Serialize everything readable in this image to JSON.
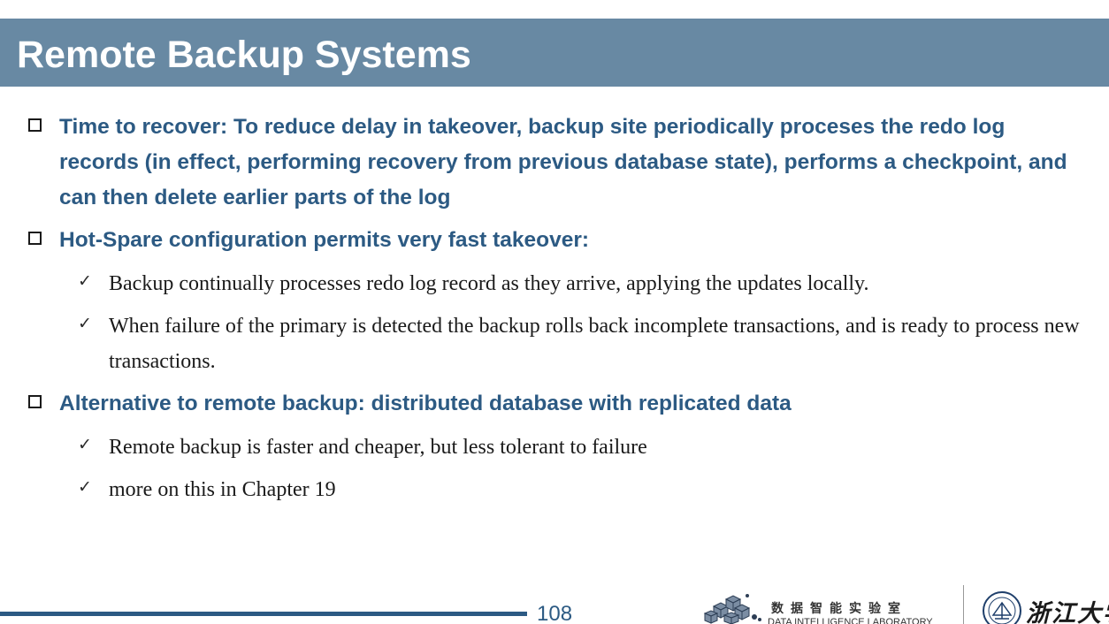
{
  "slide": {
    "title": "Remote Backup Systems",
    "bullets": [
      {
        "text": "Time to recover: To reduce delay in takeover, backup site periodically proceses the redo log records (in effect, performing recovery from previous database state), performs a checkpoint, and can then delete earlier parts of the log",
        "subitems": []
      },
      {
        "text": "Hot-Spare configuration permits very fast takeover:",
        "subitems": [
          "Backup continually processes redo log record as they arrive, applying the updates locally.",
          "When failure of the primary is detected the backup rolls back incomplete transactions, and is ready to  process new transactions."
        ]
      },
      {
        "text": "Alternative to remote backup: distributed database with replicated data",
        "subitems": [
          "Remote backup is faster and cheaper, but less tolerant to failure",
          "more on this in Chapter 19"
        ]
      }
    ],
    "check_glyph": "✓"
  },
  "footer": {
    "page_number": "108",
    "lab_name_cn": "数据智能实验室",
    "lab_name_en": "DATA INTELLIGENCE LABORATORY",
    "university_name": "浙江大学",
    "lab_icon": "cube-cluster-logo-icon",
    "seal_icon": "university-seal-icon"
  },
  "colors": {
    "title_bar": "#6889a3",
    "accent": "#2c5a83",
    "body_text": "#1a1a1a"
  }
}
